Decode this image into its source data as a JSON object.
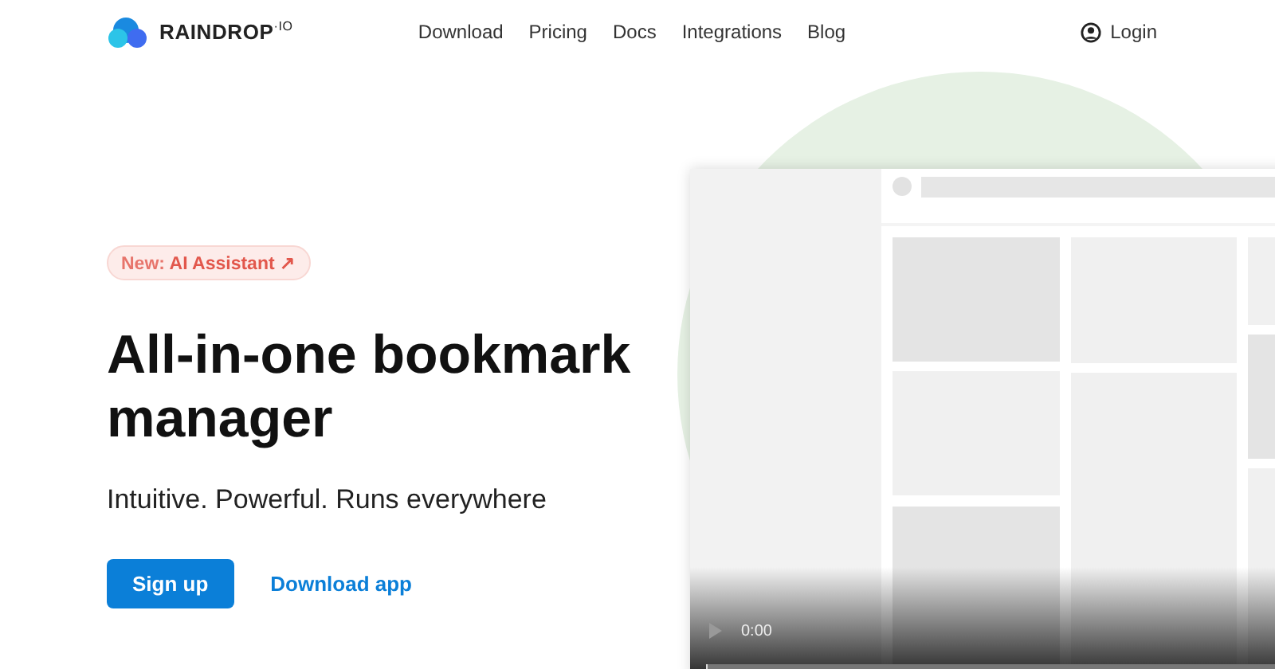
{
  "header": {
    "logo": "RAINDROP$^{·IO}$",
    "nav": [
      {
        "label": "Download"
      },
      {
        "label": "Pricing"
      },
      {
        "label": "Docs"
      },
      {
        "label": "Integrations"
      },
      {
        "label": "Blog"
      }
    ],
    "login": "Login"
  },
  "hero": {
    "badge": {
      "prefix": "New:",
      "text": "AI Assistant ↗"
    },
    "title": "All-in-one bookmark manager",
    "subtitle": "Intuitive. Powerful. Runs everywhere",
    "actions": [
      {
        "kind": "primary",
        "label": "Sign up"
      },
      {
        "kind": "link",
        "label": "Download app"
      }
    ]
  },
  "video": {
    "time": "0:00",
    "level": 0
  }
}
